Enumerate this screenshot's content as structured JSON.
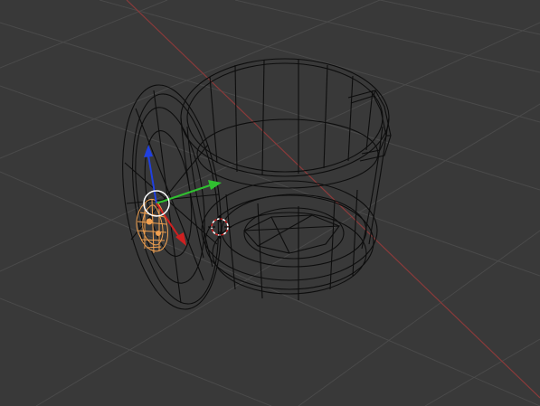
{
  "viewport": {
    "background": "#393939",
    "grid_color": "#4a4a4a",
    "axis_x_color": "#8a3a3a",
    "wire_color": "#0d0d0d",
    "selected_color": "#f0a050",
    "gizmo": {
      "x_color": "#d02020",
      "y_color": "#30c030",
      "z_color": "#2040e0",
      "center_icon": "manipulator-center-icon"
    },
    "cursor_icon": "3d-cursor-icon",
    "objects": [
      {
        "name": "pot-body",
        "selected": false
      },
      {
        "name": "pot-lid",
        "selected": false
      },
      {
        "name": "lid-handle",
        "selected": true
      }
    ]
  }
}
